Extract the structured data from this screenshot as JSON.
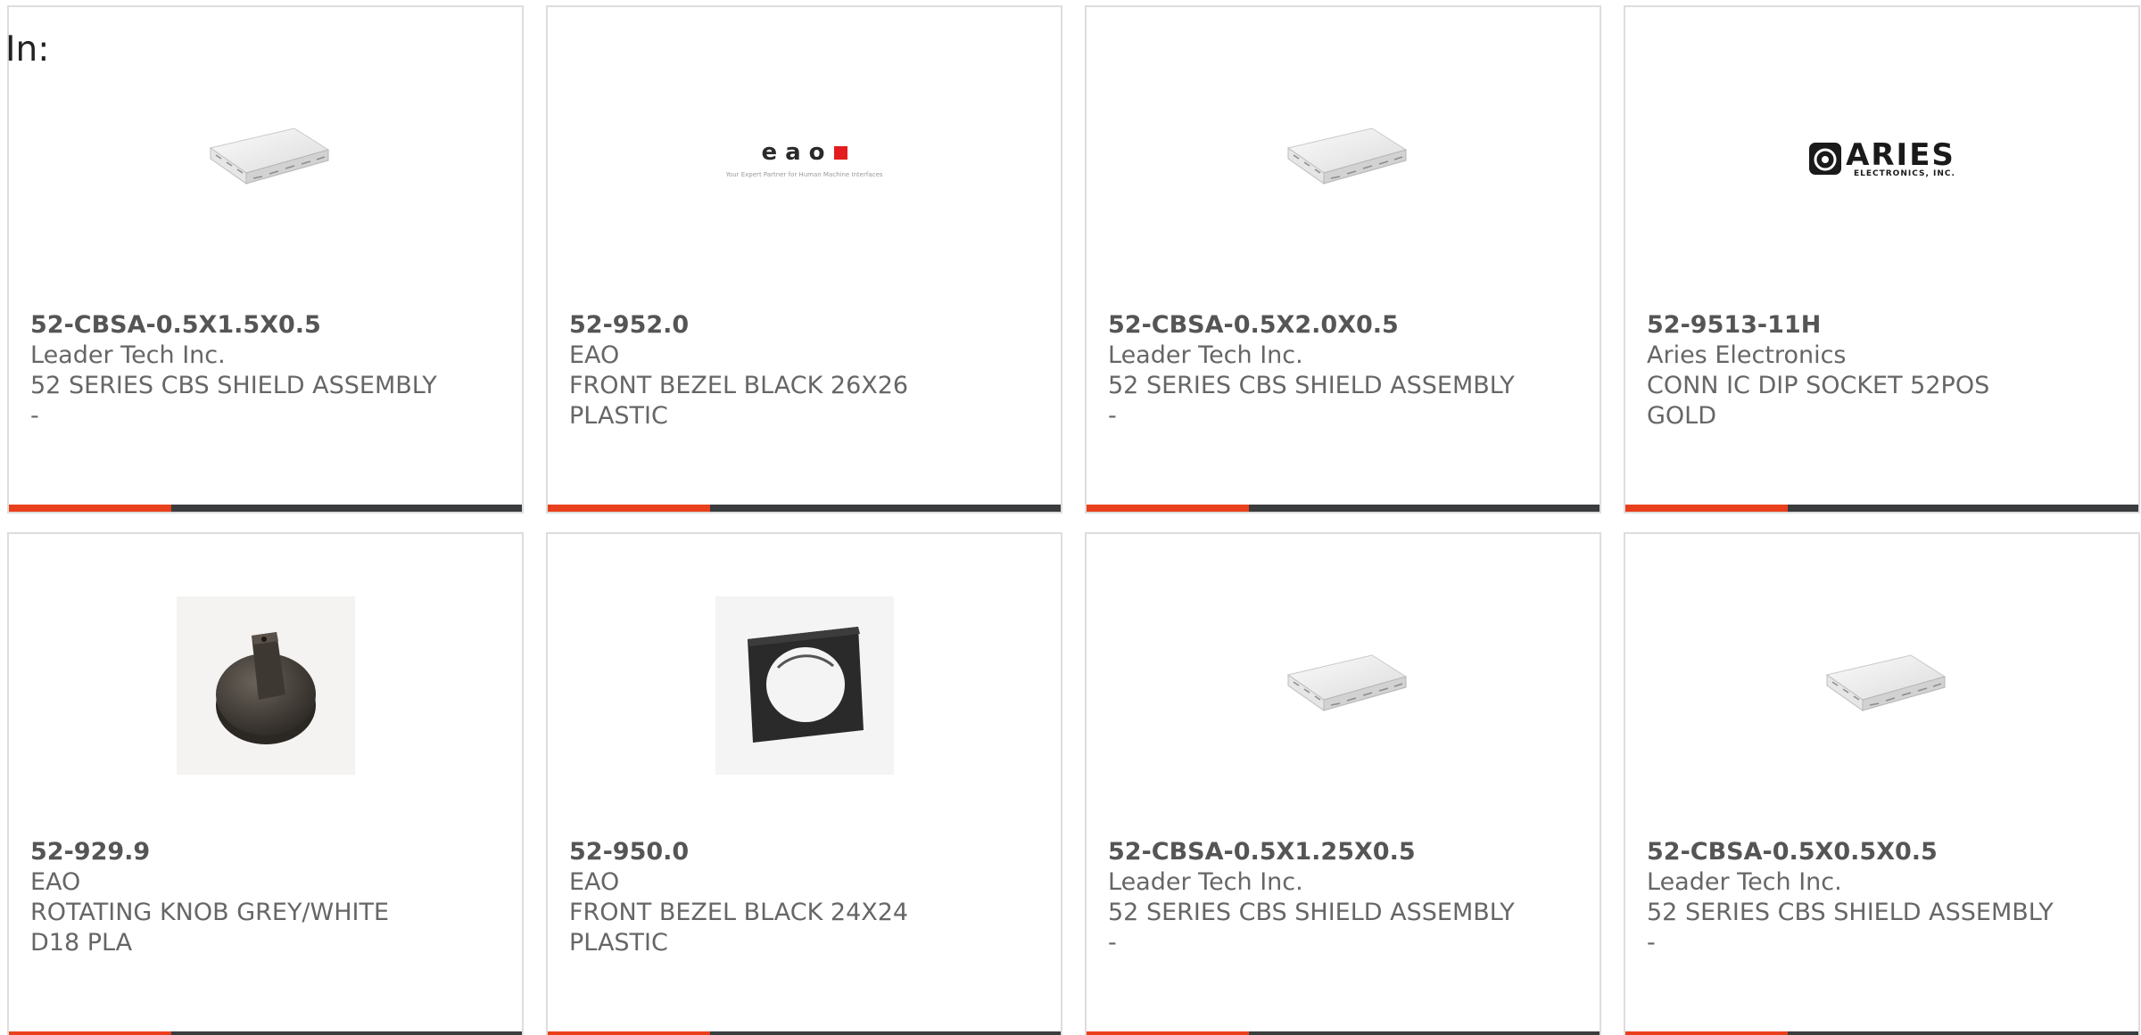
{
  "filter": {
    "in_label": "In:"
  },
  "colors": {
    "accent": "#e8401c",
    "bar_dark": "#3a3c3e",
    "border": "#dddddd",
    "text": "#666666"
  },
  "products": [
    {
      "part_number": "52-CBSA-0.5X1.5X0.5",
      "manufacturer": "Leader Tech Inc.",
      "description": "52 SERIES CBS SHIELD ASSEMBLY -",
      "image_icon": "shield-assembly-icon"
    },
    {
      "part_number": "52-952.0",
      "manufacturer": "EAO",
      "description": "FRONT BEZEL BLACK 26X26 PLASTIC",
      "image_icon": "eao-logo",
      "logo": {
        "word": "eao",
        "tagline": "Your Expert Partner for Human Machine Interfaces"
      }
    },
    {
      "part_number": "52-CBSA-0.5X2.0X0.5",
      "manufacturer": "Leader Tech Inc.",
      "description": "52 SERIES CBS SHIELD ASSEMBLY -",
      "image_icon": "shield-assembly-icon"
    },
    {
      "part_number": "52-9513-11H",
      "manufacturer": "Aries Electronics",
      "description": "CONN IC DIP SOCKET 52POS GOLD",
      "image_icon": "aries-logo",
      "logo": {
        "word": "ARIES",
        "sub": "ELECTRONICS, INC."
      }
    },
    {
      "part_number": "52-929.9",
      "manufacturer": "EAO",
      "description": "ROTATING KNOB GREY/WHITE D18 PLA",
      "image_icon": "rotating-knob-icon"
    },
    {
      "part_number": "52-950.0",
      "manufacturer": "EAO",
      "description": "FRONT BEZEL BLACK 24X24 PLASTIC",
      "image_icon": "front-bezel-icon"
    },
    {
      "part_number": "52-CBSA-0.5X1.25X0.5",
      "manufacturer": "Leader Tech Inc.",
      "description": "52 SERIES CBS SHIELD ASSEMBLY -",
      "image_icon": "shield-assembly-icon"
    },
    {
      "part_number": "52-CBSA-0.5X0.5X0.5",
      "manufacturer": "Leader Tech Inc.",
      "description": "52 SERIES CBS SHIELD ASSEMBLY -",
      "image_icon": "shield-assembly-icon"
    }
  ]
}
